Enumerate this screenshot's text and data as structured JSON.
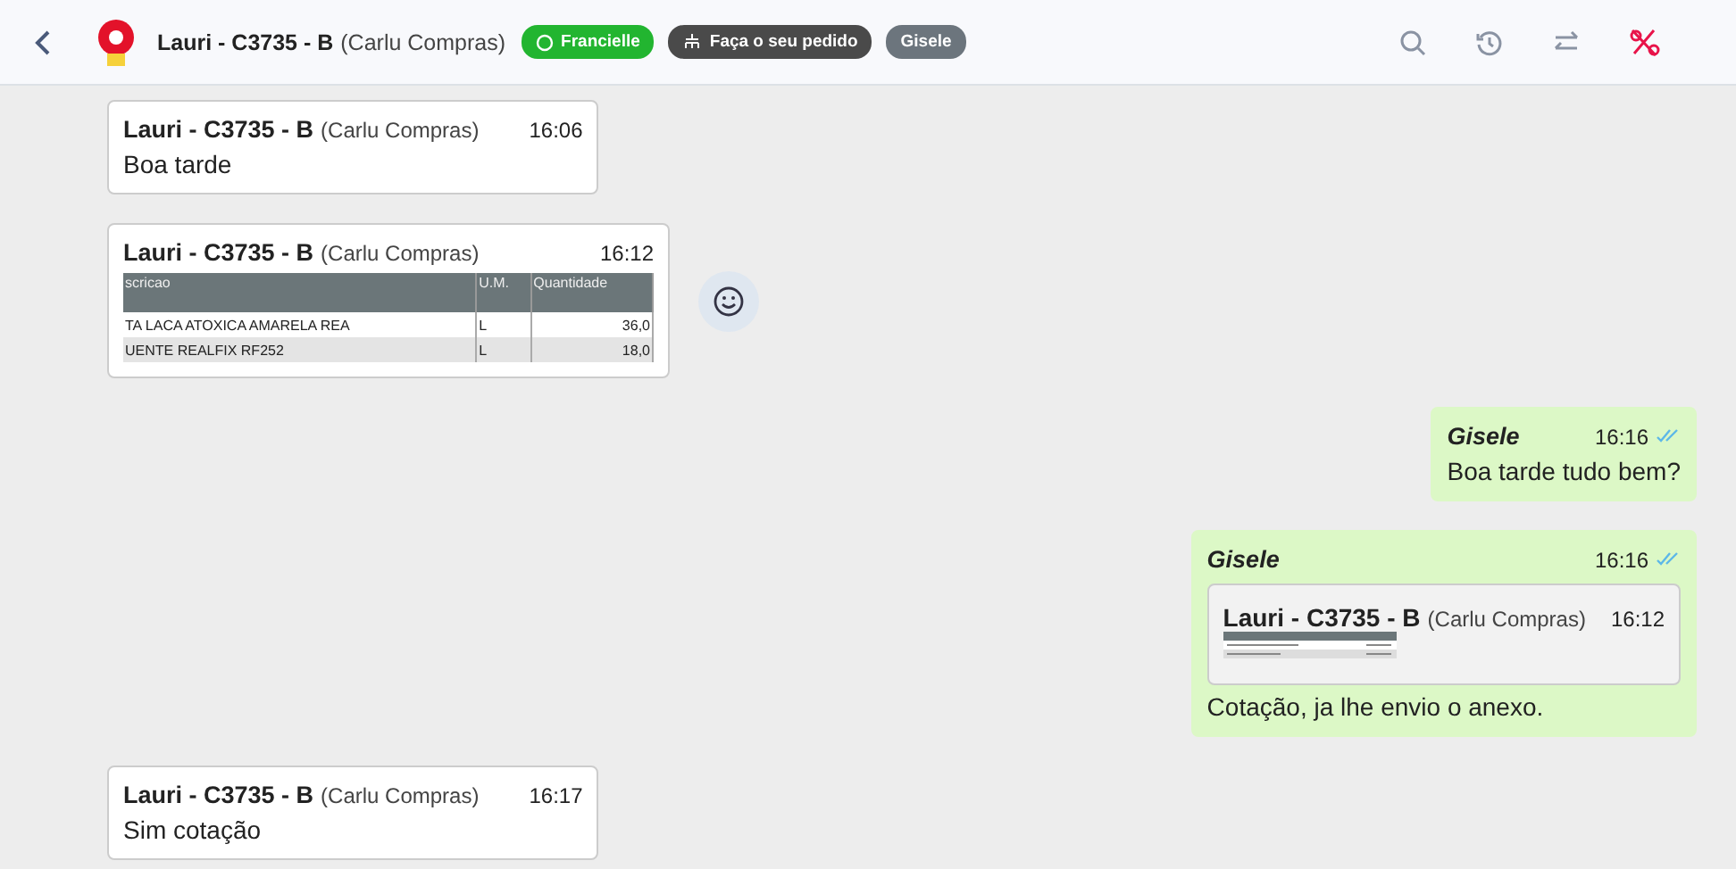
{
  "header": {
    "contact": "Lauri - C3735 - B",
    "company": "(Carlu Compras)",
    "tags": [
      {
        "kind": "whatsapp",
        "label": "Francielle",
        "color": "#22b530"
      },
      {
        "kind": "order",
        "label": "Faça o seu pedido",
        "color": "#4a4a4a"
      },
      {
        "kind": "plain",
        "label": "Gisele",
        "color": "#6c757d"
      }
    ],
    "actions": [
      {
        "kind": "search"
      },
      {
        "kind": "history"
      },
      {
        "kind": "transfer"
      },
      {
        "kind": "close-ticket"
      }
    ]
  },
  "messages": [
    {
      "kind": "text",
      "outgoing": false,
      "sender": "Lauri - C3735 - B",
      "company": "(Carlu Compras)",
      "time": "16:06",
      "text": "Boa tarde"
    },
    {
      "kind": "table",
      "outgoing": false,
      "sender": "Lauri - C3735 - B",
      "company": "(Carlu Compras)",
      "time": "16:12",
      "columns": [
        "scricao",
        "U.M.",
        "Quantidade"
      ],
      "rows": [
        [
          "TA LACA ATOXICA AMARELA REA",
          "L",
          "36,0"
        ],
        [
          "UENTE REALFIX RF252",
          "L",
          "18,0"
        ]
      ],
      "reaction": true
    },
    {
      "kind": "text",
      "outgoing": true,
      "sender": "Gisele",
      "time": "16:16",
      "read": true,
      "text": "Boa tarde tudo bem?"
    },
    {
      "kind": "quote",
      "outgoing": true,
      "sender": "Gisele",
      "time": "16:16",
      "read": true,
      "quote": {
        "sender": "Lauri - C3735 - B",
        "company": "(Carlu Compras)",
        "time": "16:12"
      },
      "text": "Cotação, ja lhe envio o anexo."
    },
    {
      "kind": "text",
      "outgoing": false,
      "sender": "Lauri - C3735 - B",
      "company": "(Carlu Compras)",
      "time": "16:17",
      "text": "Sim cotação"
    }
  ]
}
